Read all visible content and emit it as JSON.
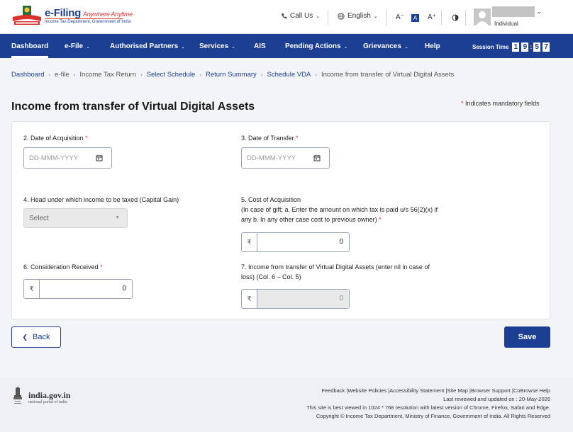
{
  "header": {
    "brand_title": "e-Filing",
    "brand_tagline": "Anywhere Anytime",
    "brand_subtitle": "Income Tax Department, Government of India",
    "call_us": "Call Us",
    "language": "English",
    "font_decrease": "A⁻",
    "font_normal": "A",
    "font_increase": "A⁺",
    "user_role": "Individual"
  },
  "nav": {
    "items": [
      {
        "label": "Dashboard",
        "has_menu": false
      },
      {
        "label": "e-File",
        "has_menu": true
      },
      {
        "label": "Authorised Partners",
        "has_menu": true
      },
      {
        "label": "Services",
        "has_menu": true
      },
      {
        "label": "AIS",
        "has_menu": false
      },
      {
        "label": "Pending Actions",
        "has_menu": true
      },
      {
        "label": "Grievances",
        "has_menu": true
      },
      {
        "label": "Help",
        "has_menu": false
      }
    ],
    "session_label": "Session Time",
    "session_digits": [
      "1",
      "9",
      "5",
      "7"
    ]
  },
  "breadcrumb": [
    "Dashboard",
    "e-file",
    "Income Tax Return",
    "Select Schedule",
    "Return Summary",
    "Schedule VDA",
    "Income from transfer of Virtual Digital Assets"
  ],
  "page": {
    "title": "Income from transfer of Virtual Digital Assets",
    "mandatory_note": "Indicates mandatory fields",
    "required_marker": "*"
  },
  "form": {
    "date_acquisition_label": "2. Date of Acquisition",
    "date_acquisition_placeholder": "DD-MMM-YYYY",
    "date_transfer_label": "3. Date of Transfer",
    "date_transfer_placeholder": "DD-MMM-YYYY",
    "head_label": "4. Head under which income to be taxed (Capital Gain)",
    "head_value": "Select",
    "cost_label_1": "5. Cost of Acquisition",
    "cost_label_2": "(In case of gift; a. Enter the amount on which tax is paid u/s 56(2)(x) if",
    "cost_label_3": "any b. In any other case cost to previous owner)",
    "cost_value": "0",
    "consideration_label": "6. Consideration Received",
    "consideration_value": "0",
    "income_label_1": "7. Income from transfer of Virtual Digital Assets (enter nil in case of",
    "income_label_2": "loss) (Col. 6 – Col. 5)",
    "income_value": "0",
    "currency_symbol": "₹"
  },
  "actions": {
    "back_label": "Back",
    "save_label": "Save"
  },
  "footer": {
    "india_title": "india.gov.in",
    "india_sub": "national portal of india",
    "links": "Feedback |Website Policies |Accessibility Statement |Site Map |Browser Support |CoBrowse Help",
    "updated": "Last reviewed and updated on : 20-May-2026",
    "best_viewed": "This site is best viewed in 1024 * 768 resolution with latest version of Chrome, Firefox, Safari and Edge.",
    "copyright": "Copyright © Income Tax Department, Ministry of Finance, Government of India. All Rights Reserved"
  },
  "colors": {
    "primary": "#1c3f94",
    "required": "#d9342b",
    "page_bg": "#f2f4f8"
  }
}
